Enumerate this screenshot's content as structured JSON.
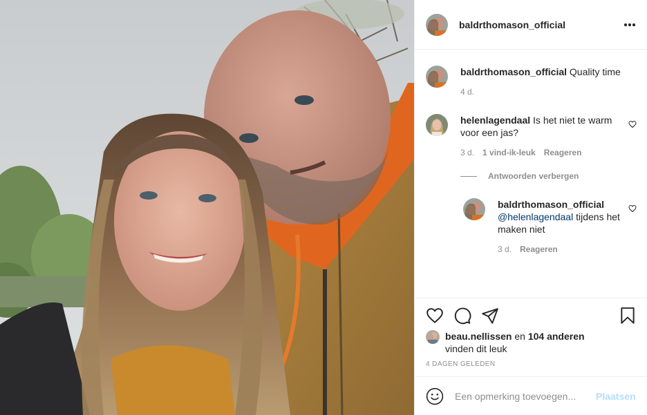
{
  "post": {
    "author": "baldrthomason_official",
    "more_icon": "more-horizontal-icon"
  },
  "caption": {
    "username": "baldrthomason_official",
    "text": "Quality time",
    "time": "4 d."
  },
  "comments": [
    {
      "username": "helenlagendaal",
      "text": "Is het niet te warm voor een jas?",
      "time": "3 d.",
      "likes": "1 vind-ik-leuk",
      "reply_label": "Reageren"
    }
  ],
  "hide_replies_label": "Antwoorden verbergen",
  "replies": [
    {
      "username": "baldrthomason_official",
      "mention": "@helenlagendaal",
      "text": "tijdens het maken niet",
      "time": "3 d.",
      "reply_label": "Reageren"
    }
  ],
  "likes": {
    "first_user": "beau.nellissen",
    "connector": "en",
    "others": "104 anderen",
    "suffix": "vinden dit leuk"
  },
  "post_date": "4 DAGEN GELEDEN",
  "comment_box": {
    "placeholder": "Een opmerking toevoegen...",
    "post_label": "Plaatsen"
  },
  "colors": {
    "link_blue": "#00376b",
    "post_button_disabled": "#b2dffc",
    "secondary_text": "#8e8e8e",
    "border": "#efefef"
  }
}
